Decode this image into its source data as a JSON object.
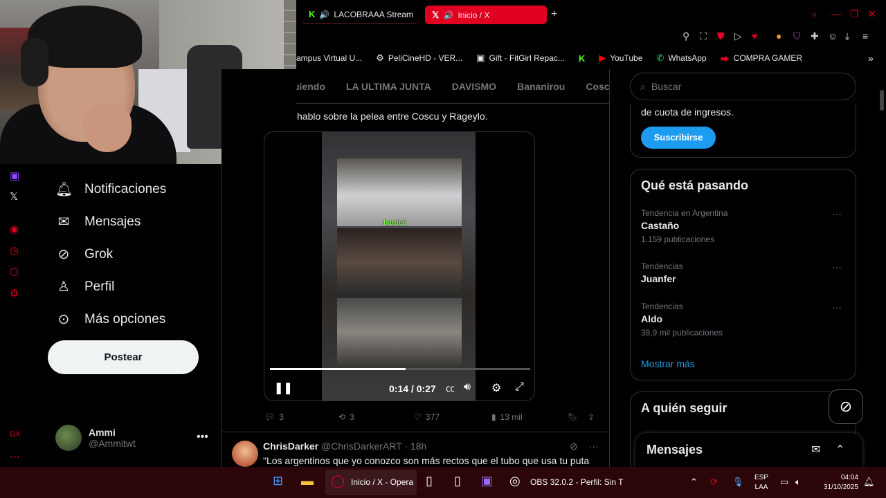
{
  "browser": {
    "tabs": [
      {
        "label": "LACOBRAAA Stream",
        "active": false
      },
      {
        "label": "Inicio / X",
        "active": true
      }
    ],
    "new_tab": "+",
    "accent": "#e0001f"
  },
  "bookmarks": [
    {
      "label": "ampus Virtual U...",
      "icon": "campus-icon"
    },
    {
      "label": "PeliCineHD - VER...",
      "icon": "film-icon"
    },
    {
      "label": "Gift - FitGirl Repac...",
      "icon": "fitgirl-icon"
    },
    {
      "label": "",
      "icon": "kick-icon"
    },
    {
      "label": "YouTube",
      "icon": "youtube-icon"
    },
    {
      "label": "WhatsApp",
      "icon": "whatsapp-icon"
    },
    {
      "label": "COMPRA GAMER",
      "icon": "compragamer-icon"
    }
  ],
  "nav": {
    "items": [
      {
        "label": "Notificaciones",
        "icon": "bell-icon"
      },
      {
        "label": "Mensajes",
        "icon": "mail-icon"
      },
      {
        "label": "Grok",
        "icon": "grok-icon"
      },
      {
        "label": "Perfil",
        "icon": "person-icon"
      },
      {
        "label": "Más opciones",
        "icon": "more-circle-icon"
      }
    ],
    "post_label": "Postear",
    "profile": {
      "name": "Ammi",
      "handle": "@Ammitwt"
    }
  },
  "center": {
    "tabs": [
      "uiendo",
      "LA ULTIMA JUNTA",
      "DAVISMO",
      "Bananirou",
      "Cosc"
    ],
    "tweet_text": "hablo sobre la pelea entre Coscu y Rageylo.",
    "video": {
      "caption": "bardeé",
      "time": "0:14 / 0:27",
      "progress": 0.52
    },
    "actions": {
      "replies": "3",
      "reposts": "3",
      "likes": "377",
      "views": "13 mil"
    },
    "next_tweet": {
      "name": "ChrisDarker",
      "handle": "@ChrisDarkerART",
      "time": "· 18h",
      "text": "\"Los argentinos que yo conozco son más rectos que el tubo que usa tu puta"
    }
  },
  "sidebar": {
    "search_placeholder": "Buscar",
    "premium_text": "de cuota de ingresos.",
    "subscribe_label": "Suscribirse",
    "trends_title": "Qué está pasando",
    "trends": [
      {
        "context": "Tendencia en Argentina",
        "name": "Castaño",
        "count": "1.159 publicaciones"
      },
      {
        "context": "Tendencias",
        "name": "Juanfer",
        "count": ""
      },
      {
        "context": "Tendencias",
        "name": "Aldo",
        "count": "38,9 mil publicaciones"
      }
    ],
    "show_more": "Mostrar más",
    "who_to_follow": "A quién seguir",
    "messages_title": "Mensajes"
  },
  "taskbar": {
    "active_app": "Inicio / X - Opera",
    "obs_label": "OBS 32.0.2 - Perfil: Sin T",
    "lang_top": "ESP",
    "lang_bottom": "LAA",
    "time": "04:04",
    "date": "31/10/2025"
  }
}
